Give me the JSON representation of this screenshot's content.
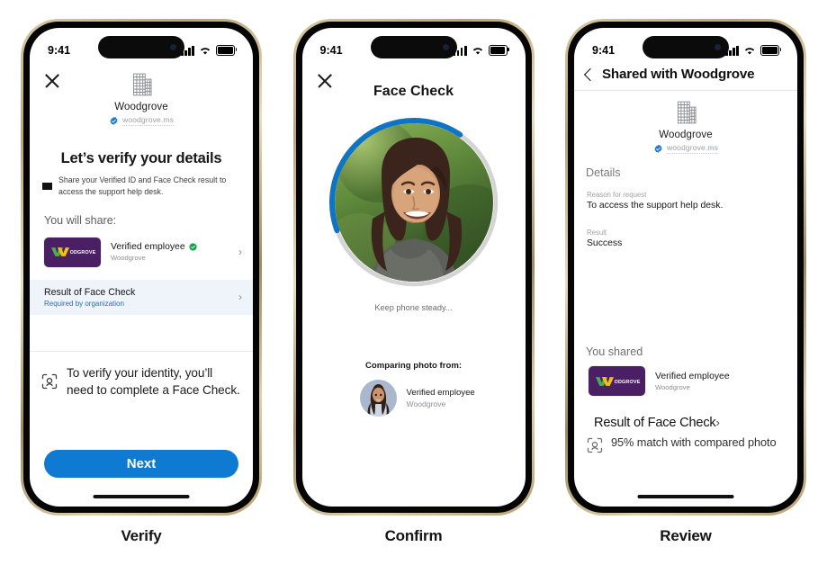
{
  "status_bar": {
    "time": "9:41",
    "signal_icon": "cellular-bars-icon",
    "wifi_icon": "wifi-icon",
    "battery_icon": "battery-icon"
  },
  "org": {
    "name": "Woodgrove",
    "domain": "woodgrove.ms",
    "building_icon": "building-icon",
    "verified_icon": "verified-badge-icon"
  },
  "screens": [
    {
      "caption": "Verify",
      "close_icon": "close-icon",
      "heading": "Let’s verify your details",
      "subtext": "Share your Verified ID and Face Check result to access the support help desk.",
      "share_label": "You will share:",
      "items": [
        {
          "logo_text": "WOODGROVE",
          "title": "Verified employee",
          "subtitle": "Woodgrove",
          "verified_icon": "green-check-icon",
          "chevron": "›",
          "highlighted": false
        },
        {
          "title": "Result of Face Check",
          "subtitle": "Required by organization",
          "chevron": "›",
          "highlighted": true
        }
      ],
      "cta_text": "To verify your identity, you’ll need to complete a Face Check.",
      "cta_icon": "face-scan-icon",
      "button_label": "Next"
    },
    {
      "caption": "Confirm",
      "close_icon": "close-icon",
      "title": "Face Check",
      "progress_percent": 40,
      "hint": "Keep phone steady...",
      "compare_label": "Comparing photo from:",
      "compare_title": "Verified employee",
      "compare_subtitle": "Woodgrove"
    },
    {
      "caption": "Review",
      "back_icon": "back-chevron-icon",
      "nav_title": "Shared with Woodgrove",
      "details_label": "Details",
      "fields": [
        {
          "label": "Reason for request",
          "value": "To access the support help desk."
        },
        {
          "label": "Result",
          "value": "Success"
        }
      ],
      "shared_label": "You shared",
      "shared_item": {
        "logo_text": "WOODGROVE",
        "title": "Verified employee",
        "subtitle": "Woodgrove"
      },
      "result_link": "Result of Face Check",
      "result_chevron": "›",
      "match_text": "95% match with compared photo",
      "match_icon": "face-scan-icon"
    }
  ],
  "colors": {
    "accent_blue": "#0f7ad1",
    "card_purple": "#4b1f63",
    "highlight_blue": "#eff4fb",
    "link_blue": "#2b6cb8",
    "green_check": "#16a34a"
  }
}
